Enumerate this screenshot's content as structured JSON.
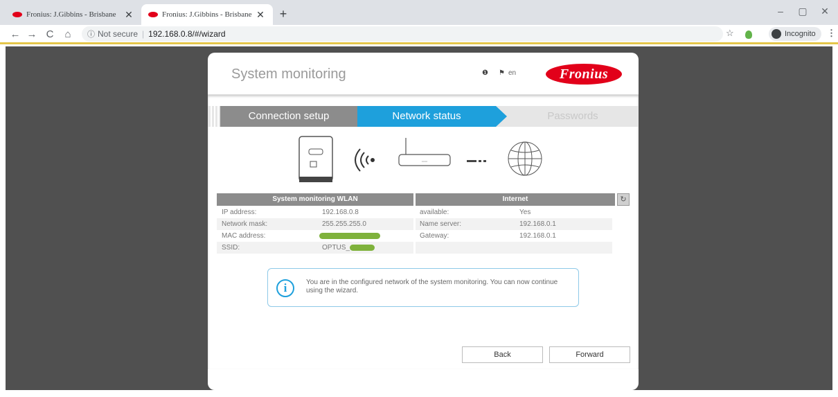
{
  "browser": {
    "tabs": [
      {
        "title": "Fronius: J.Gibbins - Brisbane",
        "active": false
      },
      {
        "title": "Fronius: J.Gibbins - Brisbane",
        "active": true
      }
    ],
    "new_tab": "+",
    "window_controls": {
      "minimize": "–",
      "maximize": "▢",
      "close": "✕"
    },
    "nav": {
      "back": "←",
      "forward": "→",
      "reload": "C",
      "home": "⌂"
    },
    "address": {
      "security_icon": "ⓘ",
      "security_label": "Not secure",
      "url": "192.168.0.8/#/wizard"
    },
    "star": "☆",
    "menu": "⋮",
    "incognito_label": "Incognito"
  },
  "app": {
    "title": "System monitoring",
    "help_icon": "❶",
    "lang_flag": "⚑",
    "language": "en",
    "logo_text": "Fronius"
  },
  "wizard": {
    "steps": [
      "Connection setup",
      "Network status",
      "Passwords"
    ],
    "active_step": 1
  },
  "network": {
    "wlan_header": "System monitoring WLAN",
    "internet_header": "Internet",
    "refresh_icon": "↻",
    "wlan_rows": [
      {
        "label": "IP address:",
        "value": "192.168.0.8"
      },
      {
        "label": "Network mask:",
        "value": "255.255.255.0"
      },
      {
        "label": "MAC address:",
        "value": ""
      },
      {
        "label": "SSID:",
        "value": "OPTUS_"
      }
    ],
    "internet_rows": [
      {
        "label": "available:",
        "value": "Yes"
      },
      {
        "label": "Name server:",
        "value": "192.168.0.1"
      },
      {
        "label": "Gateway:",
        "value": "192.168.0.1"
      }
    ]
  },
  "info": {
    "icon": "i",
    "message": "You are in the configured network of the system monitoring. You can now continue using the wizard."
  },
  "buttons": {
    "back": "Back",
    "forward": "Forward"
  },
  "colors": {
    "active_step": "#1ea0dc",
    "brand_red": "#e2001a",
    "redaction": "#7fb23c"
  }
}
